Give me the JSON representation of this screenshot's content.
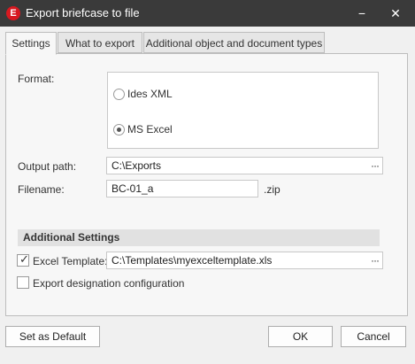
{
  "window": {
    "title": "Export briefcase to file",
    "app_icon_letter": "E",
    "minimize_glyph": "−",
    "close_glyph": "✕"
  },
  "tabs": [
    {
      "label": "Settings",
      "active": true
    },
    {
      "label": "What to export",
      "active": false
    },
    {
      "label": "Additional object and document types",
      "active": false
    }
  ],
  "settings": {
    "format_label": "Format:",
    "format_options": [
      {
        "label": "Ides XML",
        "selected": false
      },
      {
        "label": "MS Excel",
        "selected": true
      }
    ],
    "output_path_label": "Output path:",
    "output_path_value": "C:\\Exports",
    "filename_label": "Filename:",
    "filename_value": "BC-01_a",
    "filename_ext": ".zip",
    "browse_glyph": "···"
  },
  "additional_settings": {
    "header": "Additional Settings",
    "excel_template_checked": true,
    "excel_template_label": "Excel Template:",
    "excel_template_value": "C:\\Templates\\myexceltemplate.xls",
    "export_designation_checked": false,
    "export_designation_label": "Export designation configuration"
  },
  "buttons": {
    "set_default": "Set as Default",
    "ok": "OK",
    "cancel": "Cancel"
  }
}
